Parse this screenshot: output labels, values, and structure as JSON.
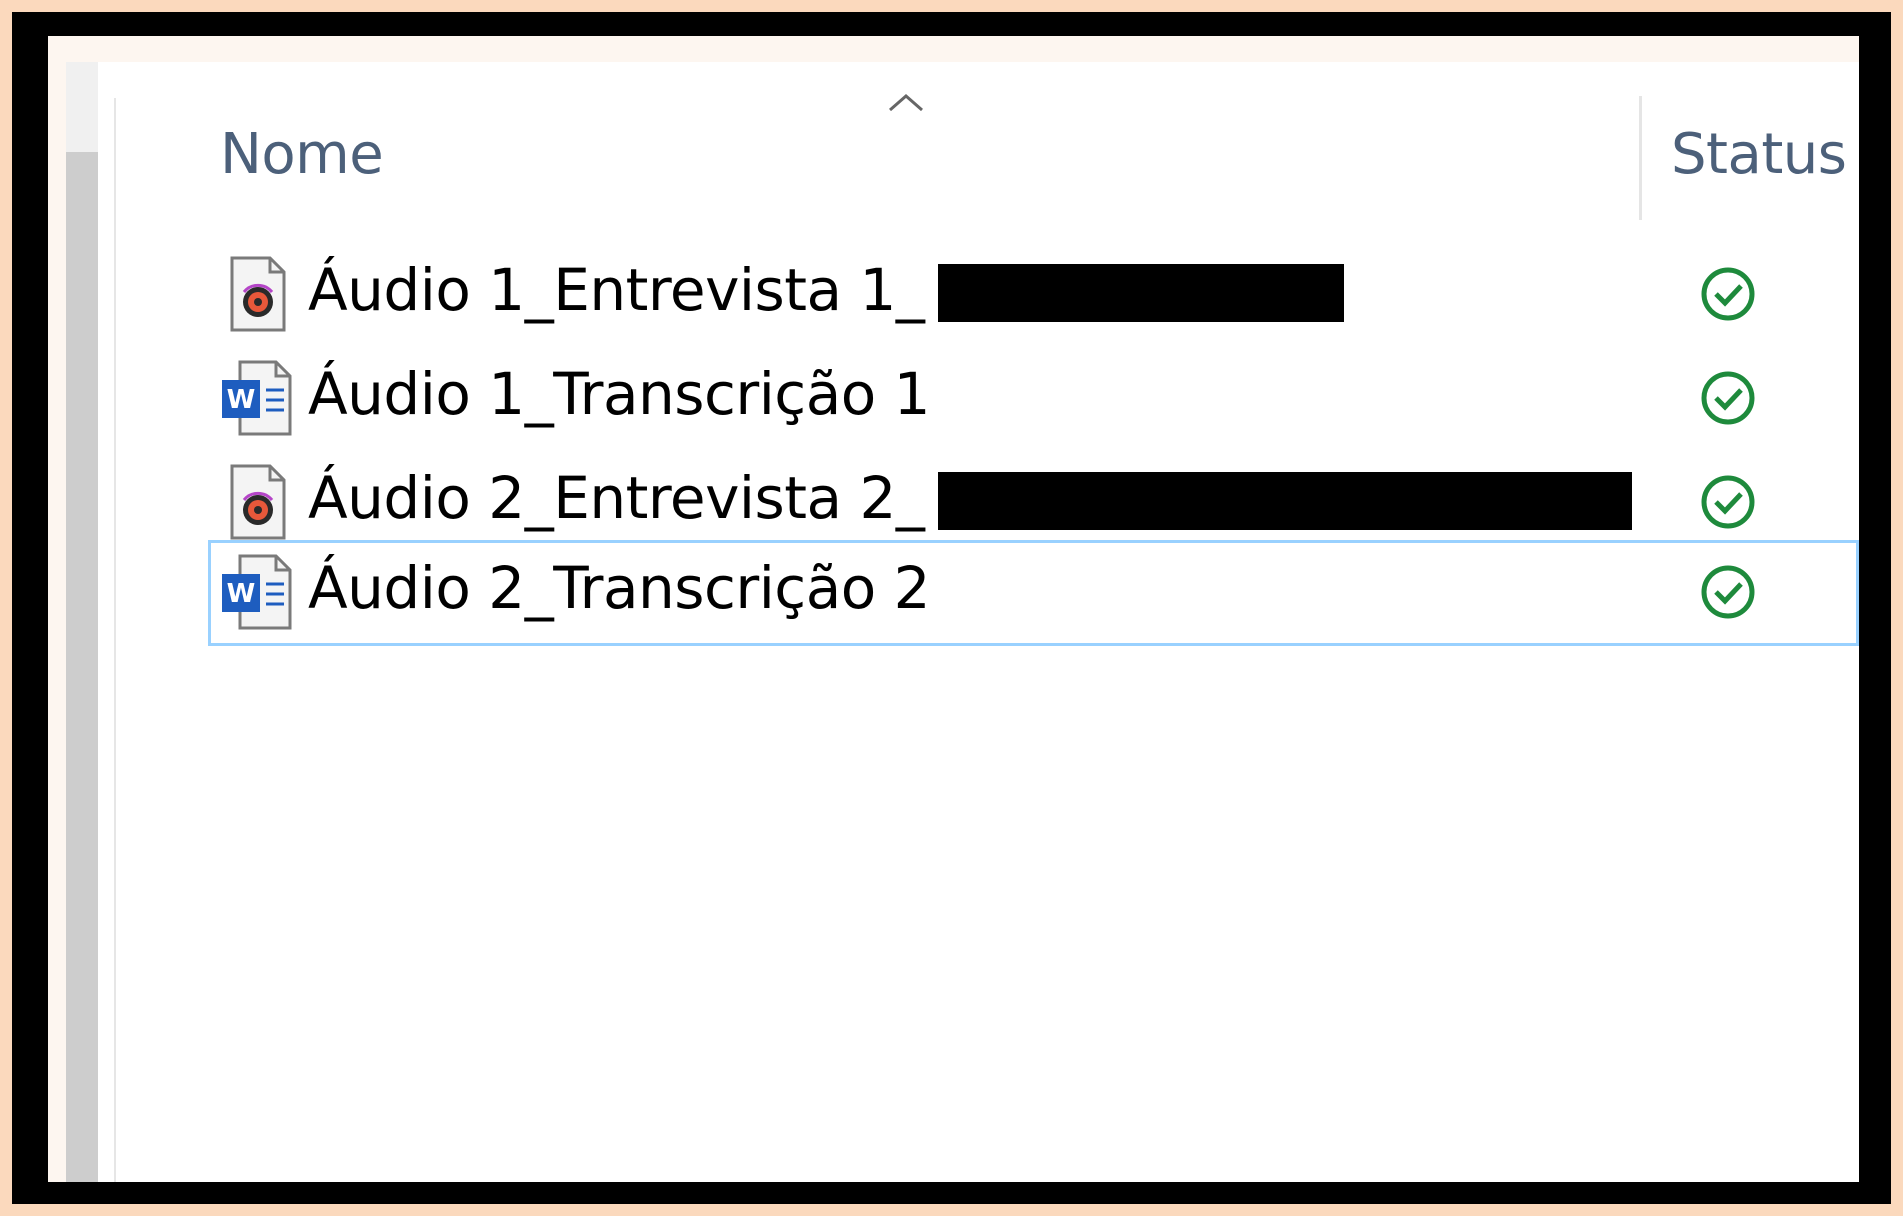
{
  "header": {
    "name_label": "Nome",
    "status_label": "Status",
    "sort_indicator": "chevron-up-icon"
  },
  "files": [
    {
      "name": "Áudio 1_Entrevista 1_",
      "type": "audio",
      "icon": "audio-file-icon",
      "status": "synced-icon",
      "redacted": true,
      "selected": false
    },
    {
      "name": "Áudio 1_Transcrição 1",
      "type": "word",
      "icon": "word-document-icon",
      "status": "synced-icon",
      "redacted": false,
      "selected": false
    },
    {
      "name": "Áudio 2_Entrevista 2_",
      "type": "audio",
      "icon": "audio-file-icon",
      "status": "synced-icon",
      "redacted": true,
      "selected": false
    },
    {
      "name": "Áudio 2_Transcrição 2",
      "type": "word",
      "icon": "word-document-icon",
      "status": "synced-icon",
      "redacted": false,
      "selected": true
    }
  ],
  "colors": {
    "status_green": "#1e8a3c",
    "selection_border": "#99d1ff",
    "word_blue": "#1e5dbf",
    "header_text": "#4c607a"
  }
}
